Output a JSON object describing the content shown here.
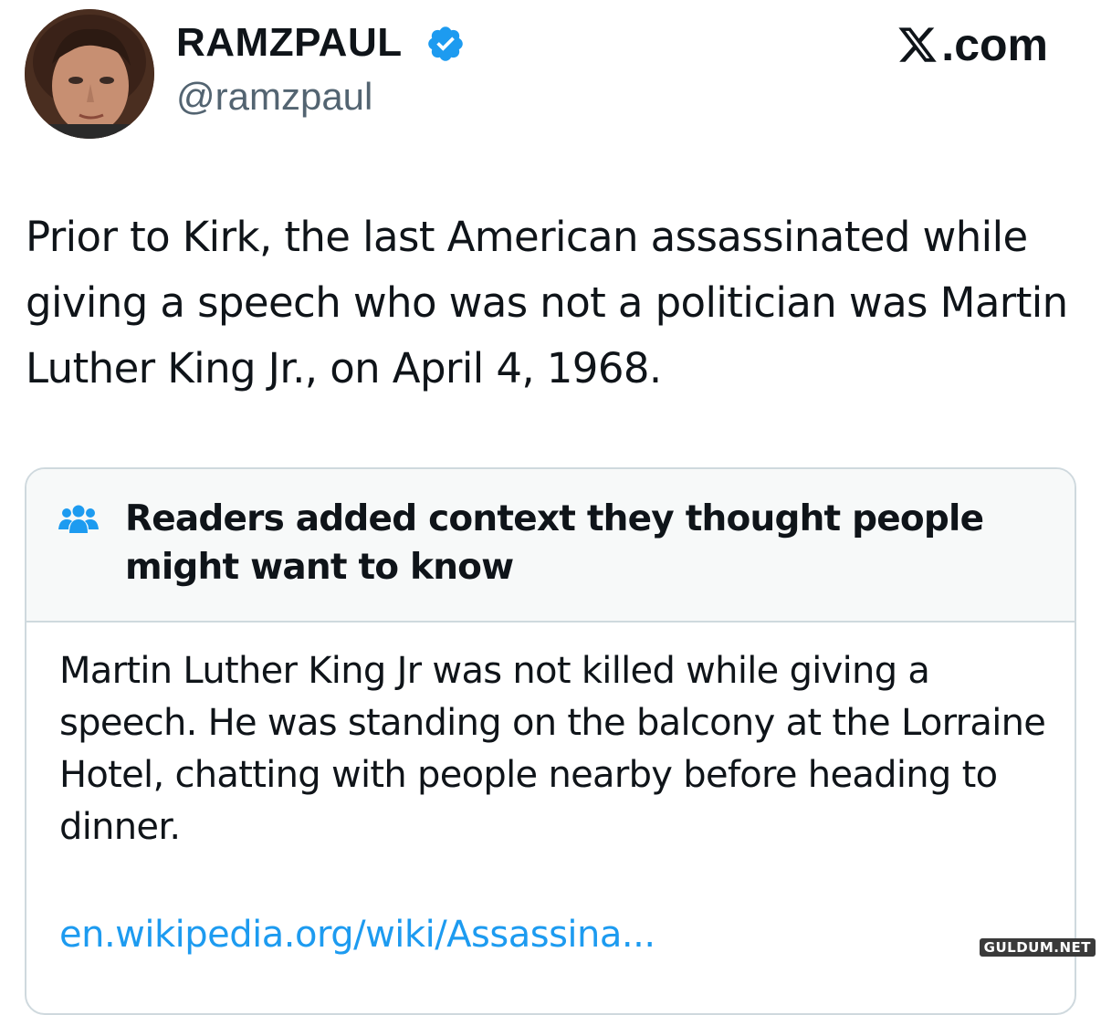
{
  "author": {
    "display_name": "RAMZPAUL",
    "handle": "@ramzpaul",
    "verified": true,
    "verified_icon": "verified-badge-icon",
    "avatar_icon": "profile-photo"
  },
  "brand": {
    "logo_icon": "x-logo-icon",
    "suffix": ".com"
  },
  "tweet": {
    "text": "Prior to Kirk, the last American assassinated while giving a speech who was not a politician was Martin Luther King Jr., on April 4, 1968."
  },
  "community_note": {
    "icon": "people-group-icon",
    "title": "Readers added context they thought people might want to know",
    "body": "Martin Luther King Jr was not killed while giving a speech. He was standing on the balcony at the Lorraine Hotel, chatting with people nearby before heading to dinner.",
    "link_text": "en.wikipedia.org/wiki/Assassina..."
  },
  "watermark": {
    "text": "GULDUM.NET"
  },
  "colors": {
    "text_primary": "#0f1419",
    "text_secondary": "#536471",
    "accent_blue": "#1d9bf0",
    "note_header_bg": "#f7f9f9",
    "border": "#cfd9de"
  }
}
